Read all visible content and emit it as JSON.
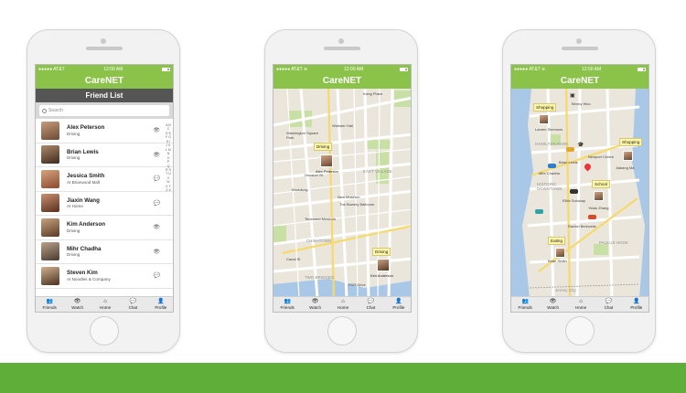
{
  "colors": {
    "brand_green": "#8bc34a",
    "band_green": "#5fae3a",
    "subheader": "#555555",
    "callout": "#fff6a6"
  },
  "status_bar": {
    "carrier": "●●●●● AT&T",
    "carrier_wifi": "●●●●● AT&T ≋",
    "time": "12:00 AM"
  },
  "app_title": "CareNET",
  "tabs": [
    {
      "icon": "friends-icon",
      "glyph": "👥",
      "label": "Friends"
    },
    {
      "icon": "eye-icon",
      "glyph": "👁",
      "label": "Watch"
    },
    {
      "icon": "home-icon",
      "glyph": "⌂",
      "label": "Home"
    },
    {
      "icon": "chat-icon",
      "glyph": "💬",
      "label": "Chat"
    },
    {
      "icon": "profile-icon",
      "glyph": "👤",
      "label": "Profile"
    }
  ],
  "friend_list": {
    "title": "Friend List",
    "search_placeholder": "Search",
    "alphabet": "A B C D E F G H I J K L M N O P Q R S T U V W X Y Z #",
    "friends": [
      {
        "name": "Alex Peterson",
        "status": "Driving",
        "icon": "eye-icon",
        "glyph": "👁"
      },
      {
        "name": "Brian Lewis",
        "status": "Driving",
        "icon": "eye-icon",
        "glyph": "👁"
      },
      {
        "name": "Jessica Smith",
        "status": "At Briarwood Mall",
        "icon": "chat-icon",
        "glyph": "💬"
      },
      {
        "name": "Jiaxin Wang",
        "status": "At Home",
        "icon": "chat-icon",
        "glyph": "💬"
      },
      {
        "name": "Kim Anderson",
        "status": "Driving",
        "icon": "eye-icon",
        "glyph": "👁"
      },
      {
        "name": "Mihr Chadha",
        "status": "Driving",
        "icon": "eye-icon",
        "glyph": "👁"
      },
      {
        "name": "Steven Kim",
        "status": "At Noodles & Company",
        "icon": "chat-icon",
        "glyph": "💬"
      }
    ]
  },
  "map2": {
    "labels": [
      "Irving Plaza",
      "Webster Hall",
      "Washington Square Park",
      "Houston St",
      "EAST VILLAGE",
      "New Museum",
      "The Bowery Ballroom",
      "Tenement Museum",
      "CHINATOWN",
      "TWO BRIDGES",
      "FDR Drive",
      "Canal St",
      "Broadway"
    ],
    "callouts": [
      "Driving",
      "Driving"
    ],
    "people": [
      "Alex Peterson",
      "Kim Anderson"
    ]
  },
  "map3": {
    "labels": [
      "Benny Woo",
      "HAMILTON PARK",
      "Newport Centre",
      "HISTORIC DOWNTOWN",
      "PAULUS HOOK",
      "Brian Lewis",
      "Lauren Simmons",
      "Mihr Chadha",
      "Jiakang Ma",
      "Elliot Soloway",
      "Yidan Zhang",
      "Rachel Berkowitz",
      "Brian Smith",
      "Jersey City"
    ],
    "callouts": [
      "Shopping",
      "Shopping",
      "School",
      "Eating"
    ]
  }
}
